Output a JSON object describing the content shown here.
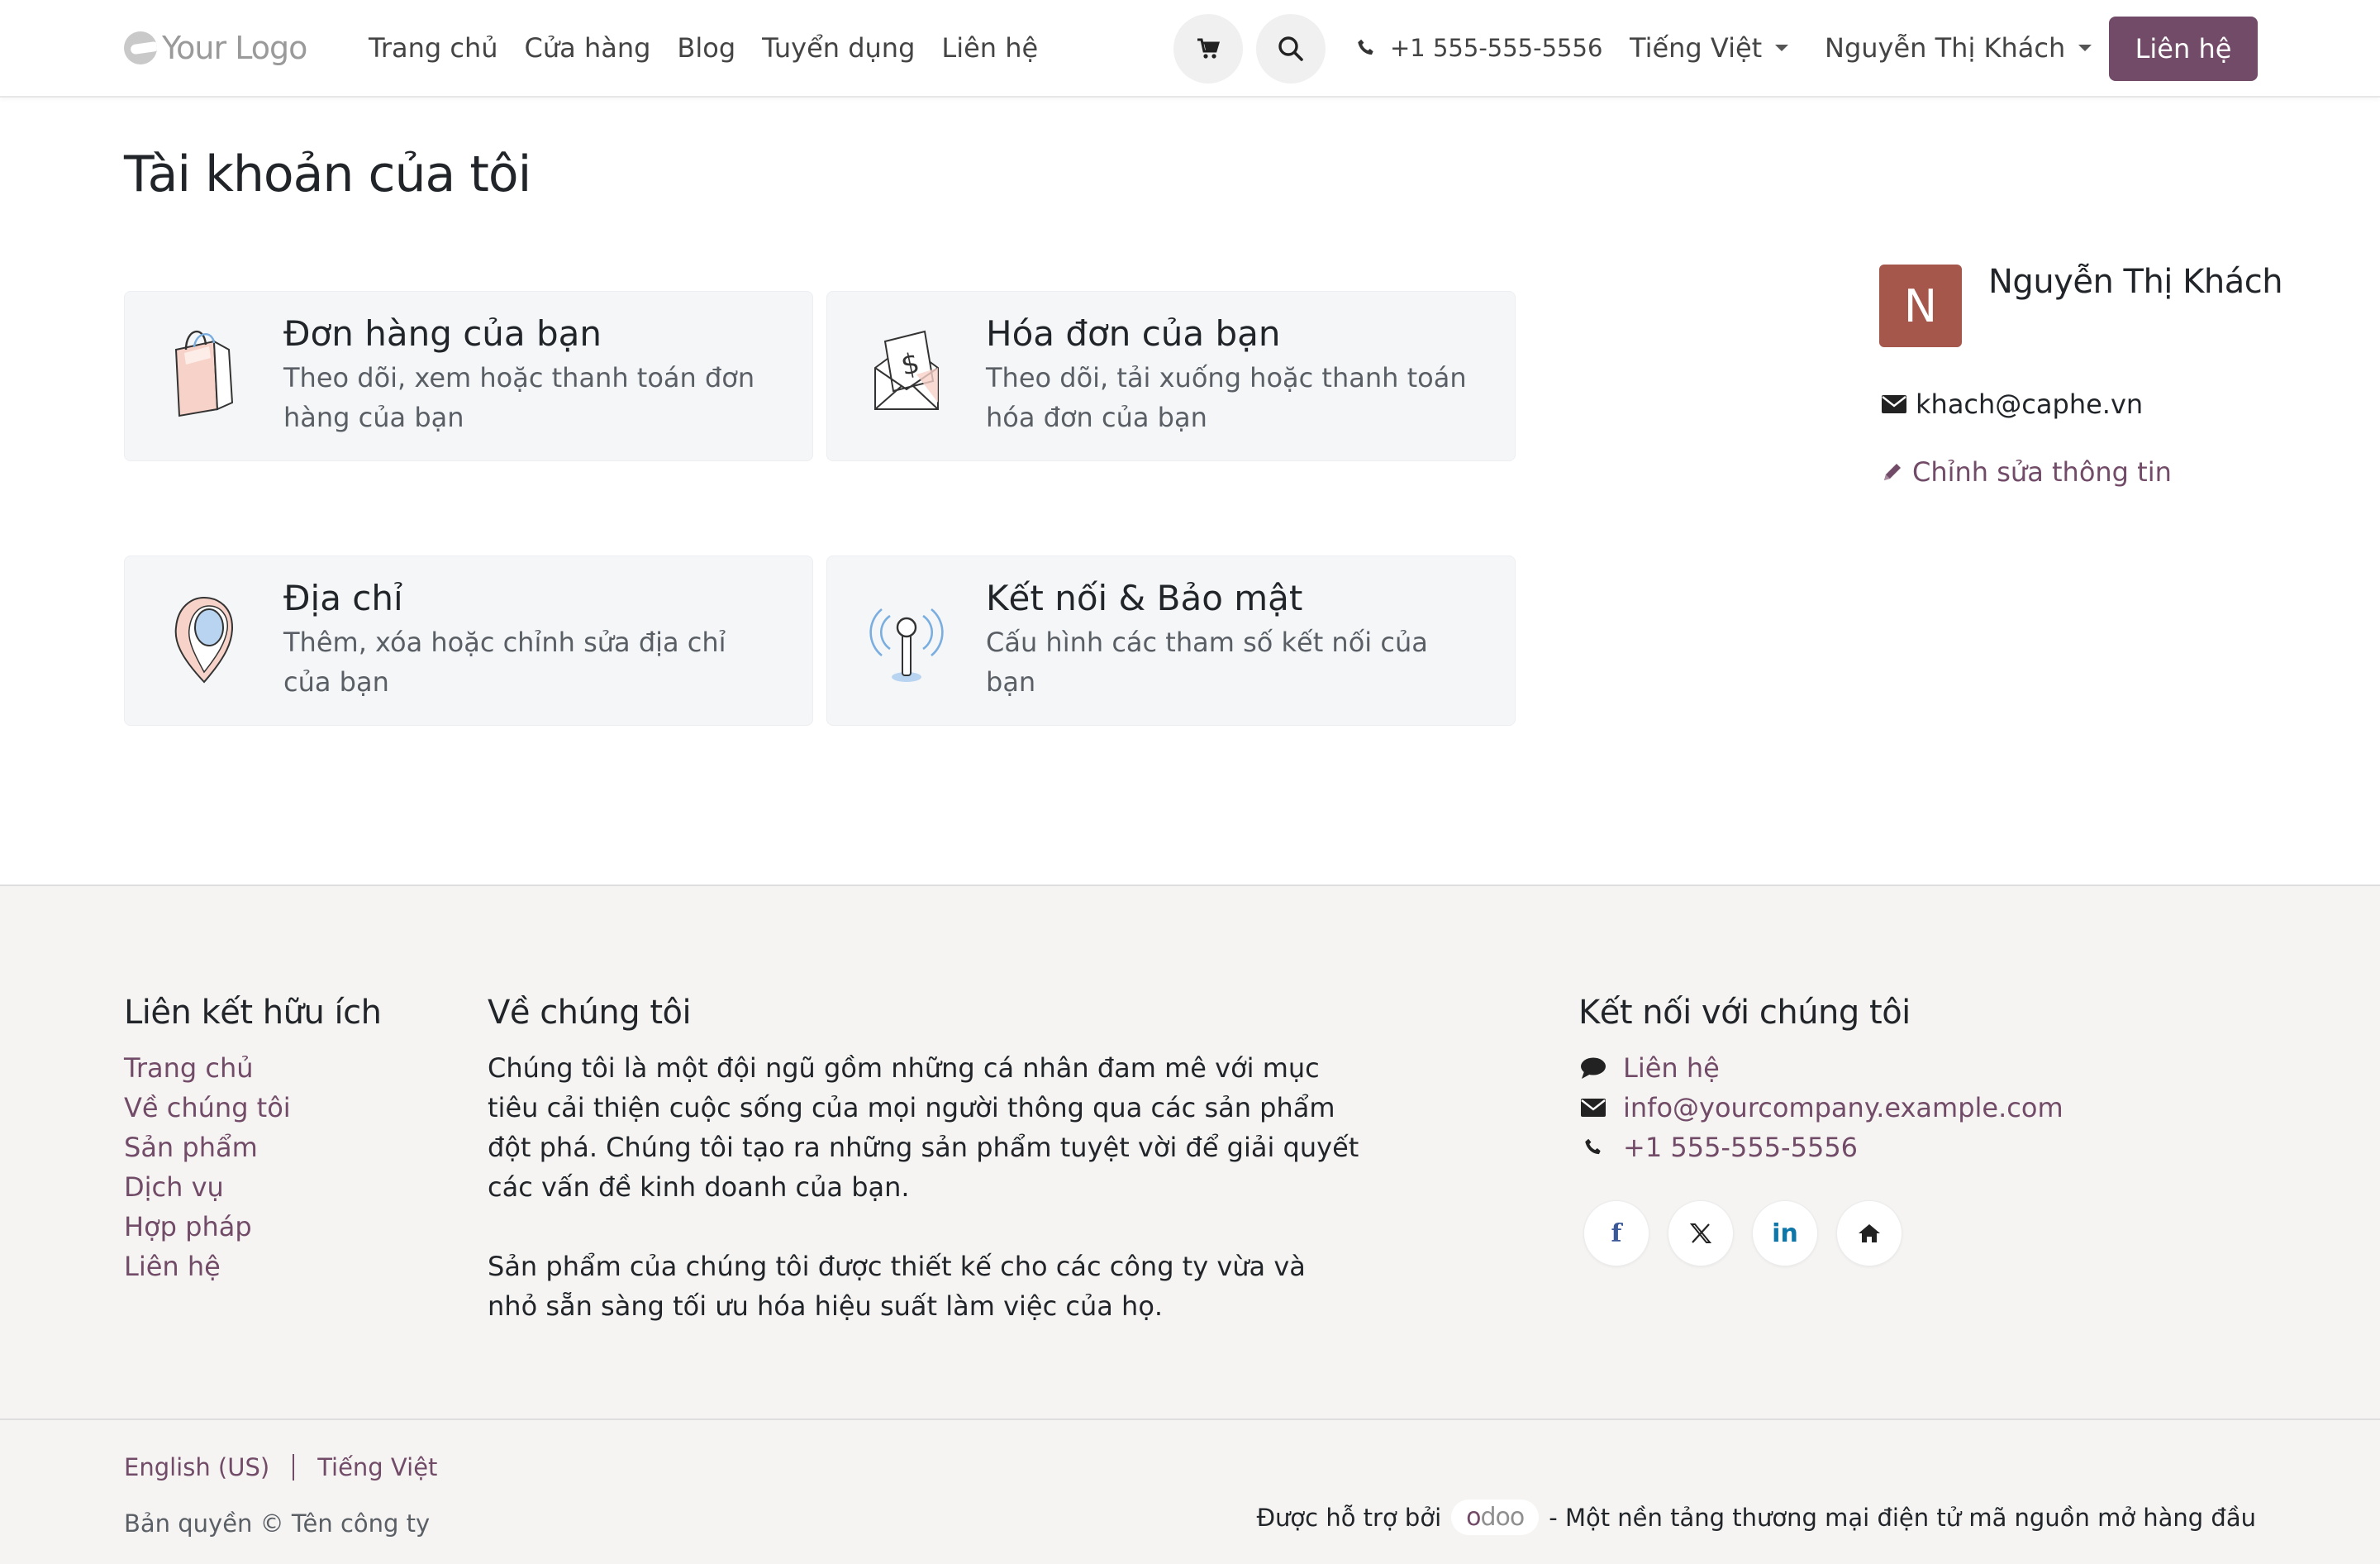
{
  "header": {
    "logo_text": "Your Logo",
    "nav": [
      "Trang chủ",
      "Cửa hàng",
      "Blog",
      "Tuyển dụng",
      "Liên hệ"
    ],
    "phone": "+1 555-555-5556",
    "language": "Tiếng Việt",
    "user": "Nguyễn Thị Khách",
    "contact_button": "Liên hệ"
  },
  "main": {
    "title": "Tài khoản của tôi",
    "cards": [
      {
        "title": "Đơn hàng của bạn",
        "desc": "Theo dõi, xem hoặc thanh toán đơn hàng của bạn",
        "icon": "shopping-bag-icon"
      },
      {
        "title": "Hóa đơn của bạn",
        "desc": "Theo dõi, tải xuống hoặc thanh toán hóa đơn của bạn",
        "icon": "invoice-envelope-icon"
      },
      {
        "title": "Địa chỉ",
        "desc": "Thêm, xóa hoặc chỉnh sửa địa chỉ của bạn",
        "icon": "map-pin-icon"
      },
      {
        "title": "Kết nối & Bảo mật",
        "desc": "Cấu hình các tham số kết nối của bạn",
        "icon": "antenna-icon"
      }
    ]
  },
  "profile": {
    "initial": "N",
    "name": "Nguyễn Thị Khách",
    "email": "khach@caphe.vn",
    "edit_label": "Chỉnh sửa thông tin"
  },
  "footer": {
    "useful_links_title": "Liên kết hữu ích",
    "useful_links": [
      "Trang chủ",
      "Về chúng tôi",
      "Sản phẩm",
      "Dịch vụ",
      "Hợp pháp",
      "Liên hệ"
    ],
    "about_title": "Về chúng tôi",
    "about_p1": "Chúng tôi là một đội ngũ gồm những cá nhân đam mê với mục tiêu cải thiện cuộc sống của mọi người thông qua các sản phẩm đột phá. Chúng tôi tạo ra những sản phẩm tuyệt vời để giải quyết các vấn đề kinh doanh của bạn.",
    "about_p2": "Sản phẩm của chúng tôi được thiết kế cho các công ty vừa và nhỏ sẵn sàng tối ưu hóa hiệu suất làm việc của họ.",
    "connect_title": "Kết nối với chúng tôi",
    "contact_link": "Liên hệ",
    "email": "info@yourcompany.example.com",
    "phone": "+1 555-555-5556",
    "social": [
      "facebook-icon",
      "x-twitter-icon",
      "linkedin-icon",
      "home-icon"
    ],
    "lang_en": "English (US)",
    "lang_vi": "Tiếng Việt",
    "copyright": "Bản quyền © Tên công ty",
    "powered_by": "Được hỗ trợ bởi",
    "odoo": "odoo",
    "tagline": "- Một nền tảng thương mại điện tử mã nguồn mở hàng đầu"
  },
  "colors": {
    "brand": "#714b67",
    "avatar": "#a4574a",
    "card_bg": "#f5f6f8",
    "footer_bg": "#f5f4f2"
  }
}
